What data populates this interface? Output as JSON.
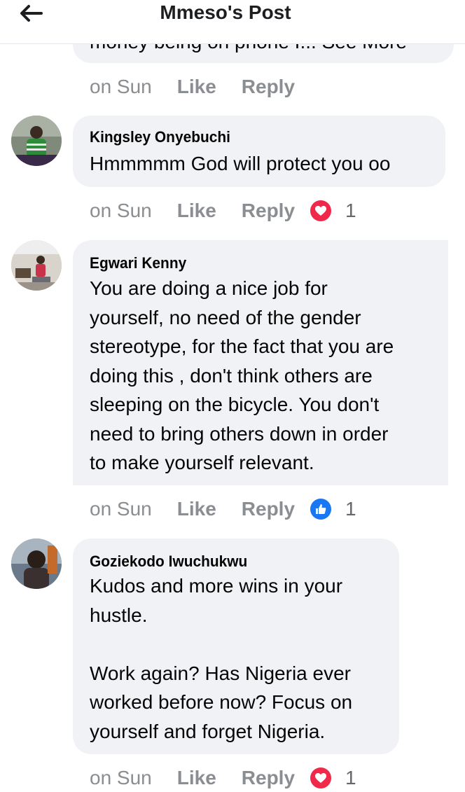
{
  "header": {
    "title": "Mmeso's Post",
    "back_icon": "arrow-left-icon"
  },
  "colors": {
    "bubble": "#f0f2f5",
    "meta_text": "#8a8d91",
    "love": "#f02849",
    "like": "#1877f2"
  },
  "top_comment": {
    "partial_text": "money being on phone I... See More",
    "meta": {
      "time": "on Sun",
      "like": "Like",
      "reply": "Reply"
    }
  },
  "comments": [
    {
      "author": "Kingsley Onyebuchi",
      "text": "Hmmmmm God will protect you oo",
      "meta": {
        "time": "on Sun",
        "like": "Like",
        "reply": "Reply",
        "reaction_icon": "love-reaction-icon",
        "reaction_count": "1"
      }
    },
    {
      "author": "Egwari Kenny",
      "text": "You are doing a nice job for\nyourself, no need of the gender\nstereotype, for the fact that you are\ndoing this , don't think others are\nsleeping on the bicycle.  You don't\nneed to bring others down in order\nto make yourself relevant.",
      "meta": {
        "time": "on Sun",
        "like": "Like",
        "reply": "Reply",
        "reaction_icon": "like-reaction-icon",
        "reaction_count": "1"
      }
    },
    {
      "author": "Goziekodo Iwuchukwu",
      "text": "Kudos and more wins in your\nhustle.\n\nWork again? Has Nigeria ever\nworked before now? Focus on\nyourself and forget Nigeria.",
      "meta": {
        "time": "on Sun",
        "like": "Like",
        "reply": "Reply",
        "reaction_icon": "love-reaction-icon",
        "reaction_count": "1"
      }
    }
  ]
}
